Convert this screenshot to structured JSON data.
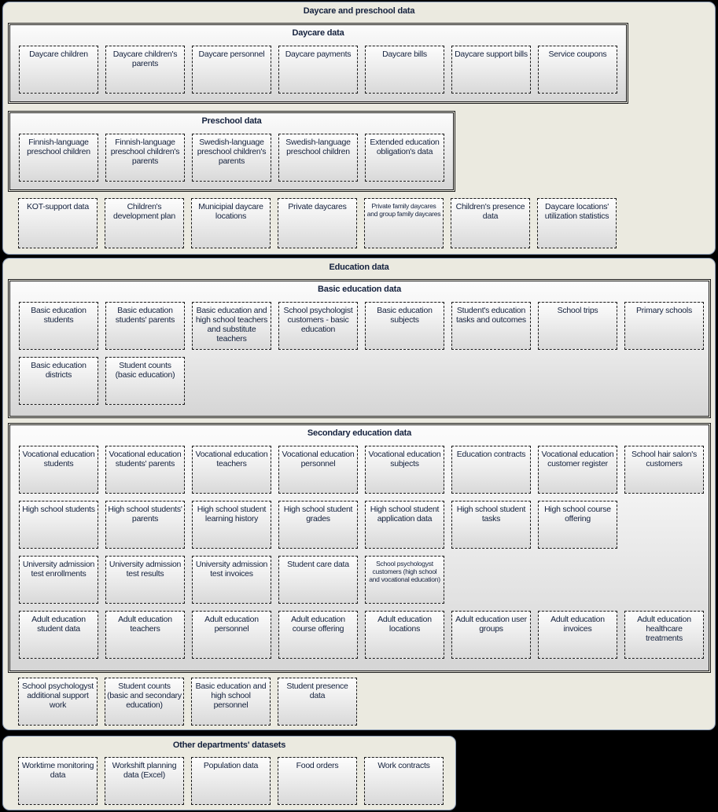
{
  "diagram": {
    "background_color": "#000000",
    "group_fill": "#ebeae0",
    "panel_gradient_top": "#fcfcfc",
    "panel_gradient_bottom": "#d5d5d5",
    "text_color": "#14213d"
  },
  "groups": [
    {
      "id": "daycare-preschool",
      "title": "Daycare and preschool data",
      "panels": [
        {
          "id": "daycare-data",
          "title": "Daycare data",
          "boxes": [
            "Daycare children",
            "Daycare children's parents",
            "Daycare personnel",
            "Daycare payments",
            "Daycare bills",
            "Daycare support bills",
            "Service coupons"
          ]
        },
        {
          "id": "preschool-data",
          "title": "Preschool data",
          "boxes": [
            "Finnish-language preschool children",
            "Finnish-language preschool children's parents",
            "Swedish-language preschool children's parents",
            "Swedish-language preschool children",
            "Extended education obligation's data"
          ]
        }
      ],
      "loose_boxes": [
        {
          "label": "KOT-support data",
          "small": false
        },
        {
          "label": "Children's development plan",
          "small": false
        },
        {
          "label": "Municipial daycare locations",
          "small": false
        },
        {
          "label": "Private daycares",
          "small": false
        },
        {
          "label": "Private family daycares and group family daycares",
          "small": true
        },
        {
          "label": "Children's presence data",
          "small": false
        },
        {
          "label": "Daycare locations' utilization statistics",
          "small": false
        }
      ]
    },
    {
      "id": "education-data",
      "title": "Education data",
      "panels": [
        {
          "id": "basic-education-data",
          "title": "Basic education data",
          "boxes": [
            "Basic education students",
            "Basic education students' parents",
            "Basic education and high school teachers and substitute teachers",
            "School psychologist customers - basic education",
            "Basic education subjects",
            "Student's education tasks and outcomes",
            "School trips",
            "Primary schools",
            "Basic education districts",
            "Student counts (basic education)"
          ]
        },
        {
          "id": "secondary-education-data",
          "title": "Secondary education data",
          "boxes": [
            {
              "label": "Vocational education students",
              "small": false
            },
            {
              "label": "Vocational education students' parents",
              "small": false
            },
            {
              "label": "Vocational education teachers",
              "small": false
            },
            {
              "label": "Vocational education personnel",
              "small": false
            },
            {
              "label": "Vocational education subjects",
              "small": false
            },
            {
              "label": "Education contracts",
              "small": false
            },
            {
              "label": "Vocational education customer register",
              "small": false
            },
            {
              "label": "School hair salon's customers",
              "small": false
            },
            {
              "label": "High school students",
              "small": false
            },
            {
              "label": "High school students' parents",
              "small": false
            },
            {
              "label": "High school student learning history",
              "small": false
            },
            {
              "label": "High school student grades",
              "small": false
            },
            {
              "label": "High school student application data",
              "small": false
            },
            {
              "label": "High school student tasks",
              "small": false
            },
            {
              "label": "High school course offering",
              "small": false
            },
            {
              "label": "University admission test enrollments",
              "small": false
            },
            {
              "label": "University admission test results",
              "small": false
            },
            {
              "label": "University admission test invoices",
              "small": false
            },
            {
              "label": "Student care data",
              "small": false
            },
            {
              "label": "School psychologyst customers (high school and vocational education)",
              "small": true
            },
            {
              "label": "Adult education student data",
              "small": false
            },
            {
              "label": "Adult education teachers",
              "small": false
            },
            {
              "label": "Adult education personnel",
              "small": false
            },
            {
              "label": "Adult education course offering",
              "small": false
            },
            {
              "label": "Adult education locations",
              "small": false
            },
            {
              "label": "Adult education user groups",
              "small": false
            },
            {
              "label": "Adult education invoices",
              "small": false
            },
            {
              "label": "Adult education healthcare treatments",
              "small": false
            }
          ]
        }
      ],
      "loose_boxes": [
        {
          "label": "School psychologyst additional support work",
          "small": false
        },
        {
          "label": "Student counts (basic and secondary education)",
          "small": false
        },
        {
          "label": "Basic education and high school personnel",
          "small": false
        },
        {
          "label": "Student presence data",
          "small": false
        }
      ]
    },
    {
      "id": "other-departments",
      "title": "Other departments' datasets",
      "panels": [],
      "loose_boxes": [
        {
          "label": "Worktime monitoring data",
          "small": false
        },
        {
          "label": "Workshift planning data (Excel)",
          "small": false
        },
        {
          "label": "Population data",
          "small": false
        },
        {
          "label": "Food orders",
          "small": false
        },
        {
          "label": "Work contracts",
          "small": false
        }
      ]
    }
  ]
}
